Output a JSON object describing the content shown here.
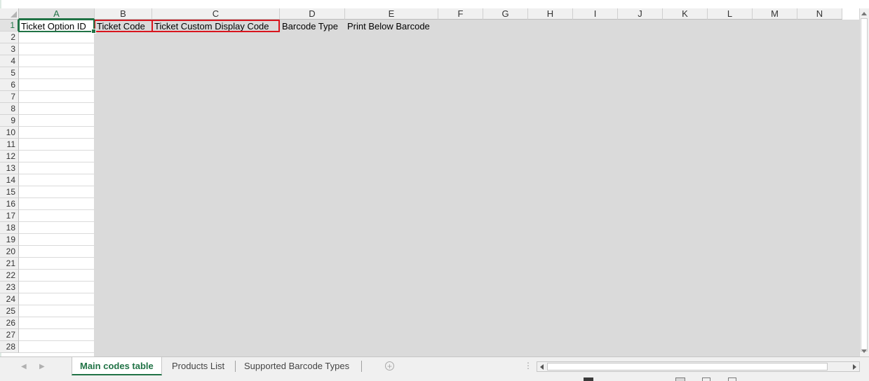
{
  "columns": [
    "A",
    "B",
    "C",
    "D",
    "E",
    "F",
    "G",
    "H",
    "I",
    "J",
    "K",
    "L",
    "M",
    "N"
  ],
  "rows": [
    "1",
    "2",
    "3",
    "4",
    "5",
    "6",
    "7",
    "8",
    "9",
    "10",
    "11",
    "12",
    "13",
    "14",
    "15",
    "16",
    "17",
    "18",
    "19",
    "20",
    "21",
    "22",
    "23",
    "24",
    "25",
    "26",
    "27",
    "28"
  ],
  "active_cell": "A1",
  "cells": {
    "A1": "Ticket Option ID",
    "B1": "Ticket Code",
    "C1": "Ticket Custom Display Code",
    "D1": "Barcode Type",
    "E1": "Print Below Barcode"
  },
  "highlighted_cells": [
    "B1",
    "C1"
  ],
  "sheet_tabs": [
    {
      "label": "Main codes table",
      "active": true
    },
    {
      "label": "Products List",
      "active": false
    },
    {
      "label": "Supported Barcode Types",
      "active": false
    }
  ],
  "colors": {
    "accent": "#217346",
    "highlight_border": "#d8151d",
    "gridline": "#dadada",
    "header_bg": "#f0f0f0"
  }
}
